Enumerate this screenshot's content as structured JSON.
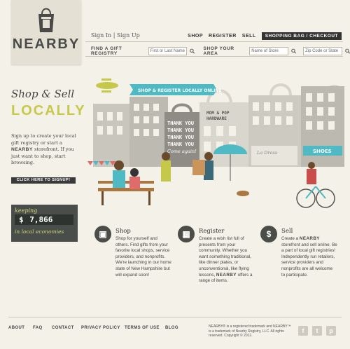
{
  "brand": {
    "name": "NEARBY"
  },
  "header": {
    "sign_in": "Sign In",
    "divider": "|",
    "sign_up": "Sign Up",
    "nav": {
      "shop": "SHOP",
      "register": "REGISTER",
      "sell": "SELL",
      "bag": "SHOPPING BAG / CHECKOUT"
    },
    "search": {
      "registry_label": "FIND A GIFT REGISTRY",
      "registry_placeholder": "First or Last Name",
      "area_label": "SHOP YOUR AREA",
      "store_placeholder": "Name of Store",
      "zip_placeholder": "Zip Code or State"
    }
  },
  "hero": {
    "heading_line1": "Shop & Sell",
    "heading_line2": "LOCALLY",
    "intro_a": "Sign up to create your local gift registry or start a ",
    "intro_brand": "NEARBY",
    "intro_b": " storefront. If you just want to shop, start browsing.",
    "cta": "CLICK HERE TO SIGNUP!",
    "banner": "SHOP & REGISTER LOCALLY ONLINE",
    "shop_sign_1": "MOM & POP",
    "shop_sign_2": "HARDWARE",
    "window_text": [
      "THANK YOU",
      "THANK YOU",
      "THANK YOU",
      "THANK YOU",
      "Come again!"
    ],
    "la_dress": "La Dress",
    "shoes": "SHOES"
  },
  "counter": {
    "prefix": "keeping",
    "currency": "$",
    "amount": "7,866",
    "suffix": "in local economies"
  },
  "features": [
    {
      "title": "Shop",
      "icon": "shopping-bag-icon",
      "text": "Shop for yourself and others. Find gifts from your favorite local shops, service providers, and nonprofits. We're launching in our home state of New Hampshire but will expand soon!"
    },
    {
      "title": "Register",
      "icon": "gift-icon",
      "text_a": "Create a wish list full of presents from your community. Whether you want something traditional, like dinner plates, or unconventional, like flying lessons, ",
      "text_brand": "NEARBY",
      "text_b": " offers a range of items."
    },
    {
      "title": "Sell",
      "icon": "dollar-icon",
      "text_a": "Create a ",
      "text_brand": "NEARBY",
      "text_b": " storefront and sell online. Be a part of local gift registries! Independently run retailers, service providers and nonprofits are all welcome to participate."
    }
  ],
  "footer": {
    "links": [
      "ABOUT",
      "FAQ",
      "CONTACT",
      "PRIVACY POLICY",
      "TERMS OF USE",
      "BLOG"
    ],
    "legal": "NEARBY® is a registered trademark and NEARBY™ is a trademark of Nearby Registry, LLC. All rights reserved. Copyright © 2012.",
    "social": [
      "facebook-icon",
      "twitter-icon",
      "pinterest-icon"
    ]
  },
  "colors": {
    "background": "#f4f1e8",
    "accent_yellow": "#c6c84a",
    "teal": "#4fb9c4",
    "dark": "#3a3a3a"
  }
}
